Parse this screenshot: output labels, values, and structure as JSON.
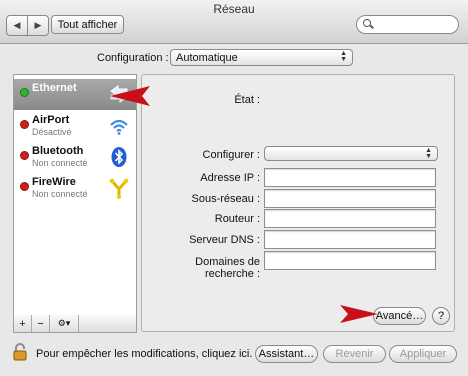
{
  "window": {
    "title": "Réseau"
  },
  "toolbar": {
    "back_glyph": "◀",
    "forward_glyph": "▶",
    "show_all_label": "Tout afficher",
    "search_placeholder": ""
  },
  "configuration": {
    "label": "Configuration :",
    "value": "Automatique"
  },
  "services": [
    {
      "name": "Ethernet",
      "status": "",
      "status_color": "#2fb52f",
      "icon": "ethernet-arrows-icon"
    },
    {
      "name": "AirPort",
      "status": "Désactivé",
      "status_color": "#d11d1d",
      "icon": "wifi-icon"
    },
    {
      "name": "Bluetooth",
      "status": "Non connecté",
      "status_color": "#d11d1d",
      "icon": "bluetooth-icon"
    },
    {
      "name": "FireWire",
      "status": "Non connecté",
      "status_color": "#d11d1d",
      "icon": "firewire-icon"
    }
  ],
  "sidebar_tools": {
    "add": "+",
    "remove": "−",
    "gear": "⚙▾"
  },
  "detail": {
    "state_label": "État :",
    "state_value": "",
    "configure_label": "Configurer :",
    "configure_value": "",
    "ip_label": "Adresse IP :",
    "ip_value": "",
    "subnet_label": "Sous-réseau :",
    "subnet_value": "",
    "router_label": "Routeur :",
    "router_value": "",
    "dns_label": "Serveur DNS :",
    "dns_value": "",
    "search_domains_label": "Domaines de recherche :",
    "search_domains_value": "",
    "advanced_label": "Avancé…",
    "help_label": "?"
  },
  "footer": {
    "lock_text": "Pour empêcher les modifications, cliquez ici.",
    "assistant_label": "Assistant…",
    "revert_label": "Revenir",
    "apply_label": "Appliquer"
  },
  "colors": {
    "annotation_arrow": "#c8101a",
    "selection": "#9a9a9a"
  }
}
